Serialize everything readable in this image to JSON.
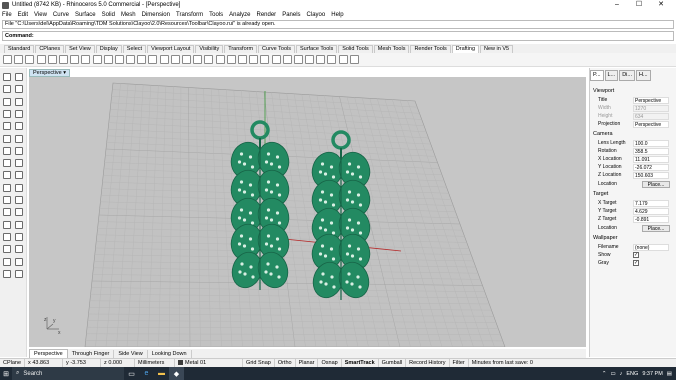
{
  "window": {
    "title": "Untitled (8742 KB) - Rhinoceros 5.0 Commercial - [Perspective]",
    "min": "–",
    "max": "☐",
    "close": "✕"
  },
  "menu": [
    "File",
    "Edit",
    "View",
    "Curve",
    "Surface",
    "Solid",
    "Mesh",
    "Dimension",
    "Transform",
    "Tools",
    "Analyze",
    "Render",
    "Panels",
    "Clayoo",
    "Help"
  ],
  "command": {
    "history": "File \"C:\\Users\\del\\AppData\\Roaming\\TDM Solutions\\Clayoo\\2.0\\Resources\\Toolbar\\Clayoo.rui\" is already open.",
    "prompt": "Command:"
  },
  "tabs": [
    "Standard",
    "CPlanes",
    "Set View",
    "Display",
    "Select",
    "Viewport Layout",
    "Visibility",
    "Transform",
    "Curve Tools",
    "Surface Tools",
    "Solid Tools",
    "Mesh Tools",
    "Render Tools",
    "Drafting",
    "New in V5"
  ],
  "active_tab": "Drafting",
  "viewport": {
    "label": "Perspective",
    "dropdown": "▾",
    "axis_z": "z",
    "axis_x": "x",
    "axis_y": "y"
  },
  "viewport_tabs": [
    "Perspective",
    "Through Finger",
    "Side View",
    "Looking Down"
  ],
  "panel": {
    "tabs": [
      "P...",
      "L...",
      "Di...",
      "H..."
    ],
    "viewport_section": "Viewport",
    "viewport_props": [
      {
        "k": "Title",
        "v": "Perspective"
      },
      {
        "k": "Width",
        "v": "1270"
      },
      {
        "k": "Height",
        "v": "634"
      },
      {
        "k": "Projection",
        "v": "Perspective"
      }
    ],
    "camera_section": "Camera",
    "camera_props": [
      {
        "k": "Lens Length",
        "v": "100.0"
      },
      {
        "k": "Rotation",
        "v": "358.5"
      },
      {
        "k": "X Location",
        "v": "11.091"
      },
      {
        "k": "Y Location",
        "v": "-26.072"
      },
      {
        "k": "Z Location",
        "v": "150.603"
      },
      {
        "k": "Location",
        "v": "Place..."
      }
    ],
    "target_section": "Target",
    "target_props": [
      {
        "k": "X Target",
        "v": "7.179"
      },
      {
        "k": "Y Target",
        "v": "4.629"
      },
      {
        "k": "Z Target",
        "v": "-0.891"
      },
      {
        "k": "Location",
        "v": "Place..."
      }
    ],
    "wallpaper_section": "Wallpaper",
    "wallpaper_props": [
      {
        "k": "Filename",
        "v": "(none)"
      },
      {
        "k": "Show",
        "v": "✓"
      },
      {
        "k": "Gray",
        "v": "✓"
      }
    ]
  },
  "status": {
    "cplane": "CPlane",
    "x": "x 43.863",
    "y": "y -3.753",
    "z": "z 0.000",
    "units": "Millimeters",
    "layer": "Metal 01",
    "items": [
      "Grid Snap",
      "Ortho",
      "Planar",
      "Osnap",
      "SmartTrack",
      "Gumball",
      "Record History",
      "Filter"
    ],
    "message": "Minutes from last save: 0"
  },
  "taskbar": {
    "search": "Search",
    "language": "ENG",
    "time": "9:37 PM"
  },
  "colors": {
    "earring": "#238a62",
    "earring_dark": "#176447",
    "grid_bg": "#c6c6c6"
  }
}
